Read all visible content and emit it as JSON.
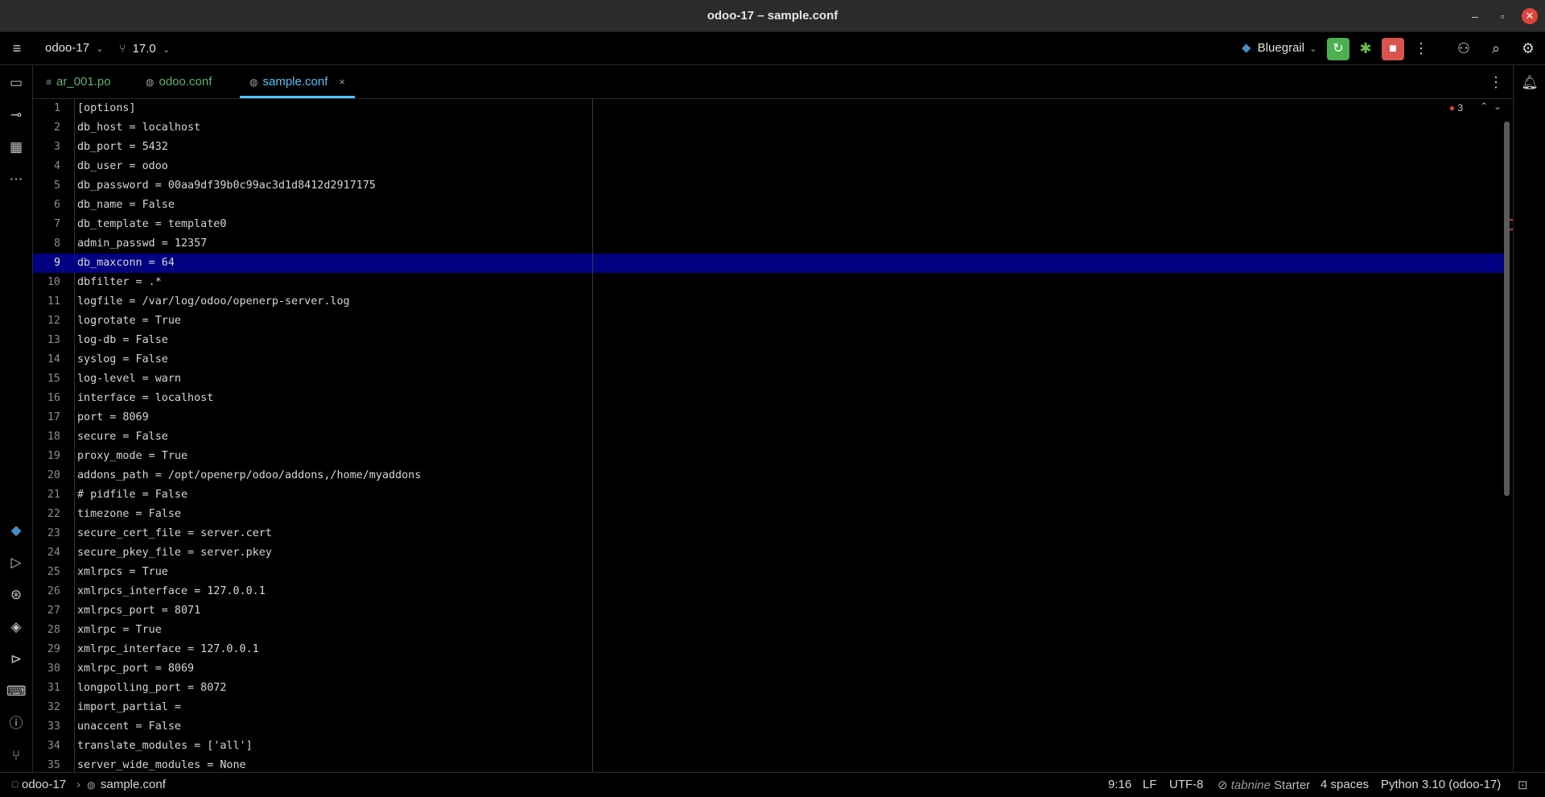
{
  "window": {
    "title": "odoo-17 – sample.conf",
    "controls": {
      "minimize": "–",
      "maximize": "▫",
      "close": "✕"
    }
  },
  "toolbar": {
    "menu_icon": "hamburger-icon",
    "project": "odoo-17",
    "branch": "17.0",
    "theme": "Bluegrail"
  },
  "tabs": [
    {
      "label": "ar_001.po",
      "icon": "po-file-icon",
      "active": false
    },
    {
      "label": "odoo.conf",
      "icon": "conf-file-icon",
      "active": false
    },
    {
      "label": "sample.conf",
      "icon": "conf-file-icon",
      "active": true,
      "close": "×"
    }
  ],
  "editor": {
    "error_count": "3",
    "current_line": 9,
    "lines": [
      "[options]",
      "db_host = localhost",
      "db_port = 5432",
      "db_user = odoo",
      "db_password = 00aa9df39b0c99ac3d1d8412d2917175",
      "db_name = False",
      "db_template = template0",
      "admin_passwd = 12357",
      "db_maxconn = 64",
      "dbfilter = .*",
      "logfile = /var/log/odoo/openerp-server.log",
      "logrotate = True",
      "log-db = False",
      "syslog = False",
      "log-level = warn",
      "interface = localhost",
      "port = 8069",
      "secure = False",
      "proxy_mode = True",
      "addons_path = /opt/openerp/odoo/addons,/home/myaddons",
      "# pidfile = False",
      "timezone = False",
      "secure_cert_file = server.cert",
      "secure_pkey_file = server.pkey",
      "xmlrpcs = True",
      "xmlrpcs_interface = 127.0.0.1",
      "xmlrpcs_port = 8071",
      "xmlrpc = True",
      "xmlrpc_interface = 127.0.0.1",
      "xmlrpc_port = 8069",
      "longpolling_port = 8072",
      "import_partial = ",
      "unaccent = False",
      "translate_modules = ['all']",
      "server_wide_modules = None"
    ]
  },
  "statusbar": {
    "breadcrumb_project": "odoo-17",
    "breadcrumb_file": "sample.conf",
    "position": "9:16",
    "line_ending": "LF",
    "encoding": "UTF-8",
    "tabnine": "tabnine",
    "tabnine_plan": "Starter",
    "indent": "4 spaces",
    "interpreter": "Python 3.10 (odoo-17)"
  },
  "colors": {
    "accent": "#4fc3f7",
    "current_line": "#000080",
    "run_green": "#4caf50",
    "stop_red": "#d9534f"
  }
}
